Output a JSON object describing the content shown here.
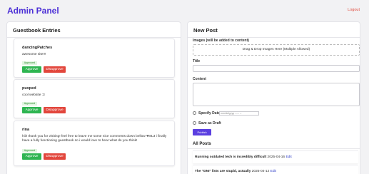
{
  "header": {
    "title": "Admin Panel",
    "logout": "Logout"
  },
  "guestbook": {
    "heading": "Guestbook Entries",
    "entries": [
      {
        "name": "dancingPatches",
        "message": "awesome site!!!",
        "status": "Approved",
        "approve": "Approve",
        "disapprove": "Disapprove"
      },
      {
        "name": "puxped",
        "message": "cool website :3",
        "status": "Approved",
        "approve": "Approve",
        "disapprove": "Disapprove"
      },
      {
        "name": "rina",
        "message": "hiii! thank you for visiting! feel free to leave me some nice comments down bellow ♥ML3 i finally have a fully functioning guestbook so i would love to hear what do you think!",
        "status": "Approved",
        "approve": "Approve",
        "disapprove": "Disapprove"
      }
    ]
  },
  "new_post": {
    "heading": "New Post",
    "images_label": "Images (will be added to content)",
    "drop_text": "Drag & Drop Images Here (Multiple Allowed)",
    "title_label": "Title",
    "content_label": "Content",
    "specify_date_label": "Specify Date",
    "date_placeholder": "mm/dd/yyyy --:-- --",
    "draft_label": "Save as Draft",
    "publish": "Publish"
  },
  "all_posts": {
    "heading": "All Posts",
    "posts": [
      {
        "title": "Running outdated tech is incredibly difficult",
        "date": "2025-04-16",
        "edit": "Edit"
      },
      {
        "title": "The \"DNI\" lists are stupid, actually",
        "date": "2025-04-12",
        "edit": "Edit"
      }
    ]
  }
}
